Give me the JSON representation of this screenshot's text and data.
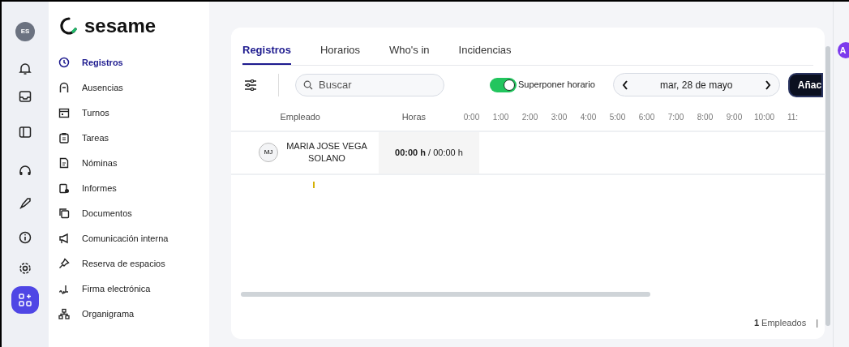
{
  "rail": {
    "avatar": "ES"
  },
  "logo": {
    "text": "sesame"
  },
  "nav": [
    {
      "label": "Registros",
      "selected": true
    },
    {
      "label": "Ausencias",
      "selected": false
    },
    {
      "label": "Turnos",
      "selected": false
    },
    {
      "label": "Tareas",
      "selected": false
    },
    {
      "label": "Nóminas",
      "selected": false
    },
    {
      "label": "Informes",
      "selected": false
    },
    {
      "label": "Documentos",
      "selected": false
    },
    {
      "label": "Comunicación interna",
      "selected": false
    },
    {
      "label": "Reserva de espacios",
      "selected": false
    },
    {
      "label": "Firma electrónica",
      "selected": false
    },
    {
      "label": "Organigrama",
      "selected": false
    }
  ],
  "tabs": [
    {
      "label": "Registros",
      "selected": true
    },
    {
      "label": "Horarios",
      "selected": false
    },
    {
      "label": "Who's in",
      "selected": false
    },
    {
      "label": "Incidencias",
      "selected": false
    }
  ],
  "toolbar": {
    "search": {
      "placeholder": "Buscar"
    },
    "toggle": {
      "label": "Superponer horario",
      "on": true
    },
    "date": "mar, 28 de mayo",
    "add_button": "Añac"
  },
  "table": {
    "columns": [
      "Empleado",
      "Horas"
    ],
    "hours": [
      "0:00",
      "1:00",
      "2:00",
      "3:00",
      "4:00",
      "5:00",
      "6:00",
      "7:00",
      "8:00",
      "9:00",
      "10:00",
      "11:"
    ],
    "rows": [
      {
        "initials": "MJ",
        "name": "MARIA JOSE VEGA SOLANO",
        "worked": "00:00 h",
        "planned": " / 00:00 h"
      }
    ]
  },
  "footer": {
    "count": "1",
    "count_label": "Empleados",
    "separator": "|"
  },
  "right_avatar": "A"
}
